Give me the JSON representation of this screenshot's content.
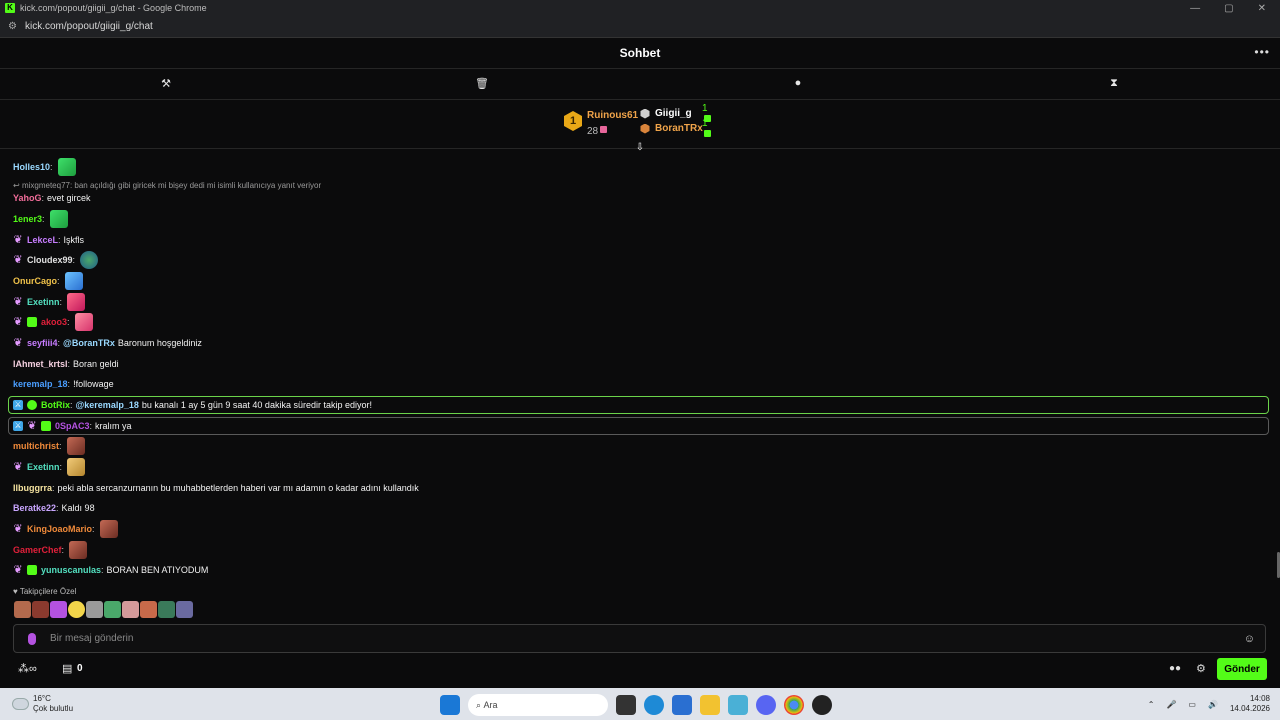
{
  "browser": {
    "window_title": "kick.com/popout/giigii_g/chat - Google Chrome",
    "logo_letter": "K",
    "url": "kick.com/popout/giigii_g/chat"
  },
  "chat": {
    "title": "Sohbet",
    "more_label": "•••"
  },
  "leaderboard": {
    "first": {
      "rank": "1",
      "name": "Ruinous61",
      "count": "28"
    },
    "rows": [
      {
        "name": "Giigii_g",
        "count": "1"
      },
      {
        "name": "BoranTRx",
        "count": "1"
      }
    ]
  },
  "reply": {
    "text": "mixgmeteq77: ban açıldığı gibi giricek mi bişey dedi mi isimli kullanıcıya yanıt veriyor"
  },
  "messages": [
    {
      "user": "Holles10",
      "text": ""
    },
    {
      "user": "YahoG",
      "text": "evet gircek"
    },
    {
      "user": "1ener3",
      "text": ""
    },
    {
      "user": "LekceL",
      "text": "Işkfls"
    },
    {
      "user": "Cloudex99",
      "text": ""
    },
    {
      "user": "OnurCago",
      "text": ""
    },
    {
      "user": "Exetinn",
      "text": ""
    },
    {
      "user": "akoo3",
      "text": ""
    },
    {
      "user": "seyfiii4",
      "mention": "@BoranTRx",
      "text": "Baronum hoşgeldiniz"
    },
    {
      "user": "lAhmet_krtsl",
      "text": "Boran geldi"
    },
    {
      "user": "keremalp_18",
      "text": "!followage"
    },
    {
      "user": "BotRix",
      "mention": "@keremalp_18",
      "text": "bu kanalı 1 ay 5 gün 9 saat 40 dakika süredir takip ediyor!"
    },
    {
      "user": "0SpAC3",
      "text": "kralım ya"
    },
    {
      "user": "multichrist",
      "text": ""
    },
    {
      "user": "Exetinn",
      "text": ""
    },
    {
      "user": "Ilbuggrra",
      "text": "peki abla sercanzurnanın bu muhabbetlerden haberi var mı adamın o kadar adını kullandık"
    },
    {
      "user": "Beratke22",
      "text": "Kaldı 98"
    },
    {
      "user": "KingJoaoMario",
      "text": ""
    },
    {
      "user": "GamerChef",
      "text": ""
    },
    {
      "user": "yunuscanulas",
      "text": "BORAN BEN ATIYODUM"
    }
  ],
  "followers_only": {
    "label": "Takipçilere Özel"
  },
  "input": {
    "placeholder": "Bir mesaj gönderin"
  },
  "bottom": {
    "store_count": "0",
    "send_label": "Gönder"
  },
  "taskbar": {
    "temperature": "16°C",
    "weather": "Çok bulutlu",
    "search": "Ara",
    "time": "14:08",
    "date": "14.04.2026"
  }
}
